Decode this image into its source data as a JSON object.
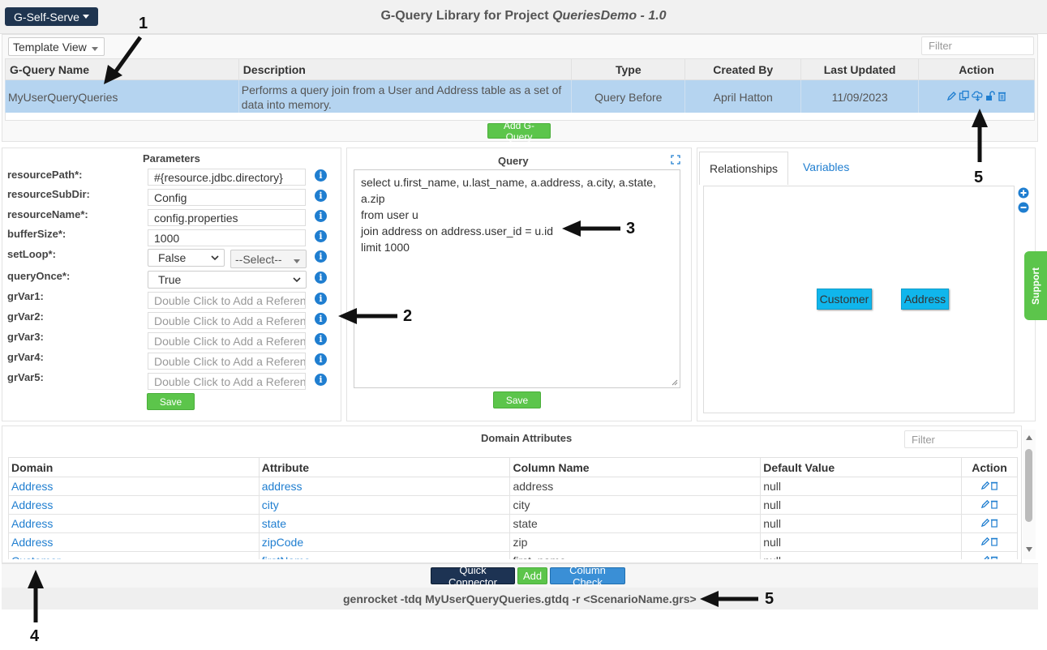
{
  "topbar": {
    "menu_button": "G-Self-Serve",
    "title_prefix": "G-Query Library for Project",
    "project_name": "QueriesDemo - 1.0"
  },
  "view_select": {
    "value": "Template View"
  },
  "filter_placeholder": "Filter",
  "queries_table": {
    "headers": [
      "G-Query Name",
      "Description",
      "Type",
      "Created By",
      "Last Updated",
      "Action"
    ],
    "rows": [
      {
        "name": "MyUserQueryQueries",
        "description": "Performs a query join from a User and Address table as a set of data into memory.",
        "type": "Query Before",
        "created_by": "April Hatton",
        "last_updated": "11/09/2023"
      }
    ]
  },
  "add_gquery_label": "Add G-Query",
  "parameters": {
    "title": "Parameters",
    "rows": [
      {
        "label": "resourcePath*:",
        "value": "#{resource.jdbc.directory}",
        "placeholder": false
      },
      {
        "label": "resourceSubDir:",
        "value": "Config",
        "placeholder": false
      },
      {
        "label": "resourceName*:",
        "value": "config.properties",
        "placeholder": false
      },
      {
        "label": "bufferSize*:",
        "value": "1000",
        "placeholder": false
      },
      {
        "label": "setLoop*:",
        "value": "False",
        "select": "--Select--"
      },
      {
        "label": "queryOnce*:",
        "value": "True"
      },
      {
        "label": "grVar1:",
        "value": "Double Click to Add a Reference",
        "placeholder": true
      },
      {
        "label": "grVar2:",
        "value": "Double Click to Add a Reference",
        "placeholder": true
      },
      {
        "label": "grVar3:",
        "value": "Double Click to Add a Reference",
        "placeholder": true
      },
      {
        "label": "grVar4:",
        "value": "Double Click to Add a Reference",
        "placeholder": true
      },
      {
        "label": "grVar5:",
        "value": "Double Click to Add a Reference",
        "placeholder": true
      }
    ],
    "save_label": "Save",
    "info_glyph": "i"
  },
  "query": {
    "title": "Query",
    "lines": [
      "select u.first_name, u.last_name, a.address, a.city, a.state,",
      "a.zip",
      "from user u",
      "join address on address.user_id = u.id",
      "limit 1000"
    ],
    "save_label": "Save"
  },
  "relationships": {
    "tabs": [
      "Relationships",
      "Variables"
    ],
    "entities": [
      "Customer",
      "Address"
    ]
  },
  "support_label": "Support",
  "domain_attributes": {
    "title": "Domain Attributes",
    "headers": [
      "Domain",
      "Attribute",
      "Column Name",
      "Default Value",
      "Action"
    ],
    "rows": [
      {
        "domain": "Address",
        "attribute": "address",
        "column": "address",
        "default": "null"
      },
      {
        "domain": "Address",
        "attribute": "city",
        "column": "city",
        "default": "null"
      },
      {
        "domain": "Address",
        "attribute": "state",
        "column": "state",
        "default": "null"
      },
      {
        "domain": "Address",
        "attribute": "zipCode",
        "column": "zip",
        "default": "null"
      },
      {
        "domain": "Customer",
        "attribute": "firstName",
        "column": "first_name",
        "default": "null"
      }
    ],
    "buttons": {
      "quick_connector": "Quick Connector",
      "add": "Add",
      "column_check": "Column Check"
    }
  },
  "command_line": "genrocket -tdq MyUserQueryQueries.gtdq -r <ScenarioName.grs>",
  "callouts": [
    "1",
    "2",
    "3",
    "4",
    "5",
    "5"
  ],
  "colors": {
    "accent_blue": "#1f7ed0",
    "green": "#5cc54b",
    "selected_row": "#b5d4f0",
    "entity": "#10b6ec"
  }
}
